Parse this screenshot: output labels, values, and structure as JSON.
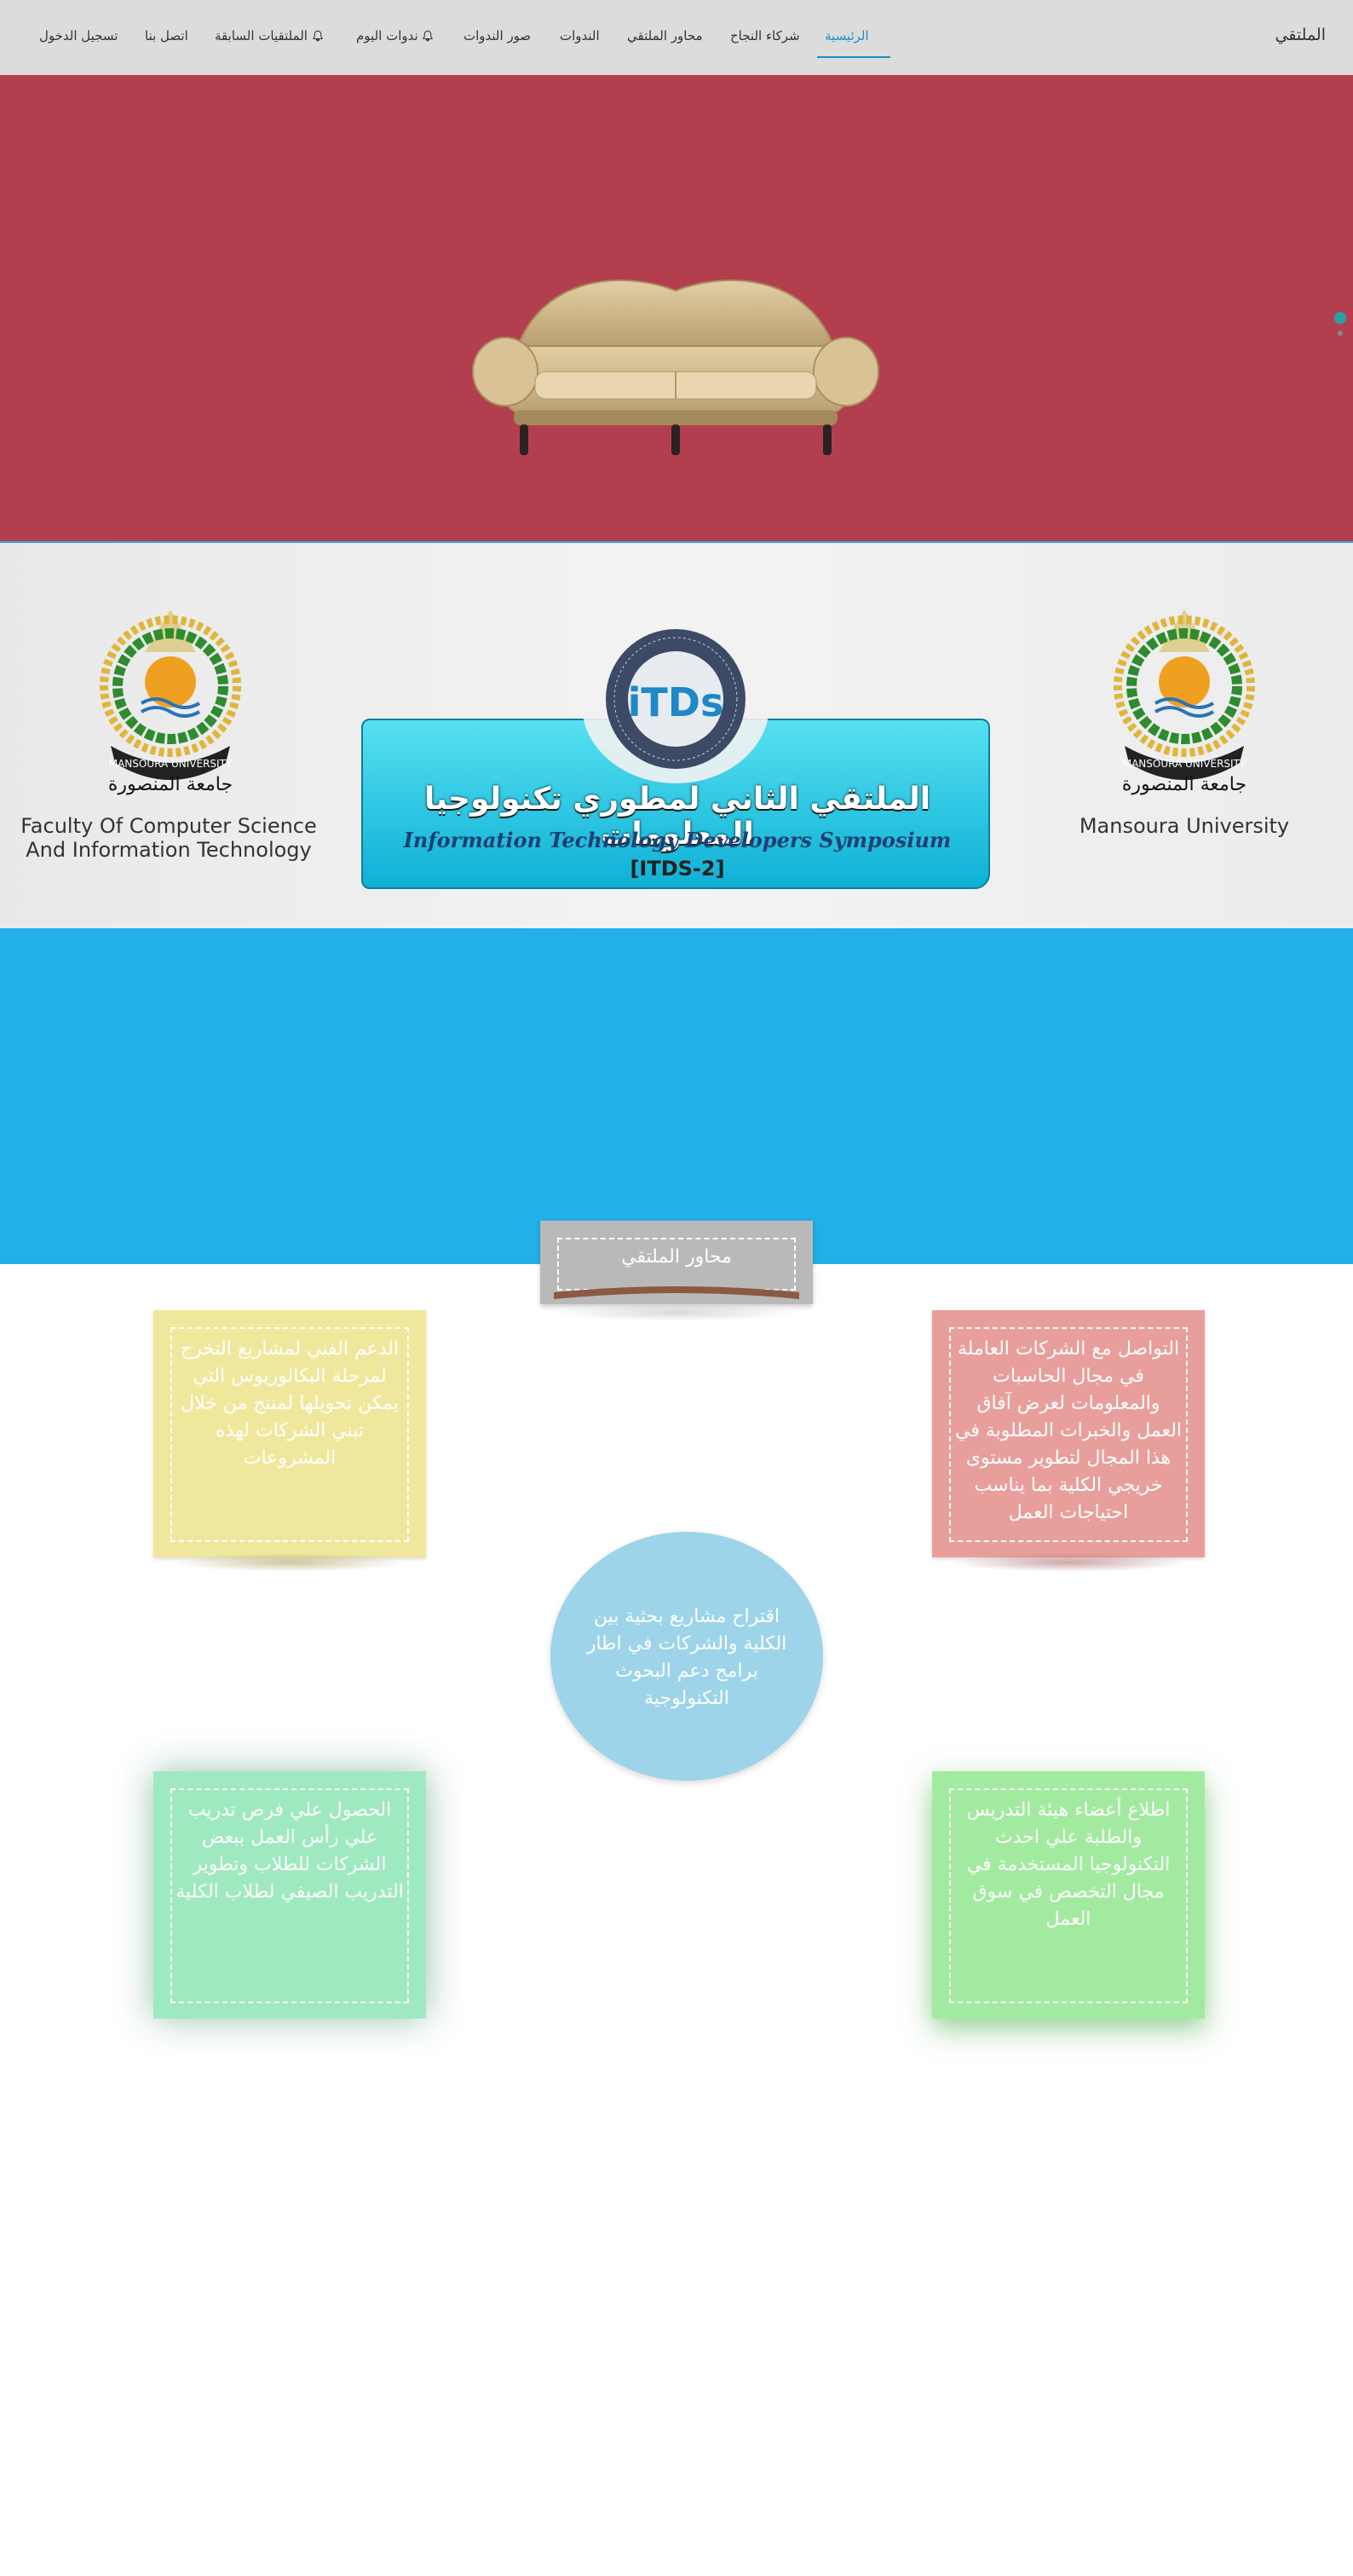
{
  "navbar": {
    "brand": "الملتقي",
    "items": [
      {
        "label": "الرئيسية",
        "active": true
      },
      {
        "label": "شركاء النجاح"
      },
      {
        "label": "محاور الملتقي"
      },
      {
        "label": "الندوات"
      },
      {
        "label": "صور الندوات"
      },
      {
        "label": "ندوات اليوم",
        "icon": "bell-icon"
      },
      {
        "label": "الملتقيات السابقة",
        "icon": "bell-icon"
      },
      {
        "label": "اتصل بنا"
      },
      {
        "label": "تسجيل الدخول"
      }
    ]
  },
  "colors": {
    "hero_bg": "#b33f4e",
    "blue_band": "#22b0e8",
    "active_link": "#1f8ec9",
    "card_yellow": "#efe89c",
    "card_red": "#e89f9c",
    "card_teal": "#9fe9c1",
    "card_green": "#a3eaa1",
    "circle_blue": "#9dd4e9"
  },
  "logos": {
    "left_caption": "Faculty Of Computer Science And Information Technology",
    "right_caption": "Mansoura University",
    "seal_text_en": "MANSOURA UNIVERSITY",
    "seal_text_ar": "جامعة المنصورة",
    "banner": {
      "arabic": "الملتقي الثاني لمطوري تكنولوجيا المعلومات",
      "english": "Information Technology Developers Symposium",
      "code": "[ITDS-2]",
      "badge": "iTDs"
    }
  },
  "section": {
    "title": "محاور الملتقي"
  },
  "cards": {
    "yellow": "الدعم الفني لمشاريع التخرج لمرحلة البكالوريوس التي يمكن تحويلها لمنتج من خلال تبني الشركات لهذه المشروعات",
    "red": "التواصل مع الشركات العاملة في مجال الحاسبات والمعلومات لعرض آفاق العمل والخبرات المطلوبة في هذا المجال لتطوير مستوى خريجي الكلية بما يناسب احتياجات العمل",
    "circle": "اقتراح مشاريع بحثية بين الكلية والشركات في اطار برامج دعم البحوث التكنولوجية",
    "teal": "الحصول علي فرص تدريب علي رأس العمل ببعض الشركات للطلاب وتطوير التدريب الصيفي لطلاب الكلية",
    "green": "اطلاع أعضاء هيئة التدريس والطلبة علي احدث التكنولوجيا المستخدمة في مجال التخصص في سوق العمل"
  }
}
